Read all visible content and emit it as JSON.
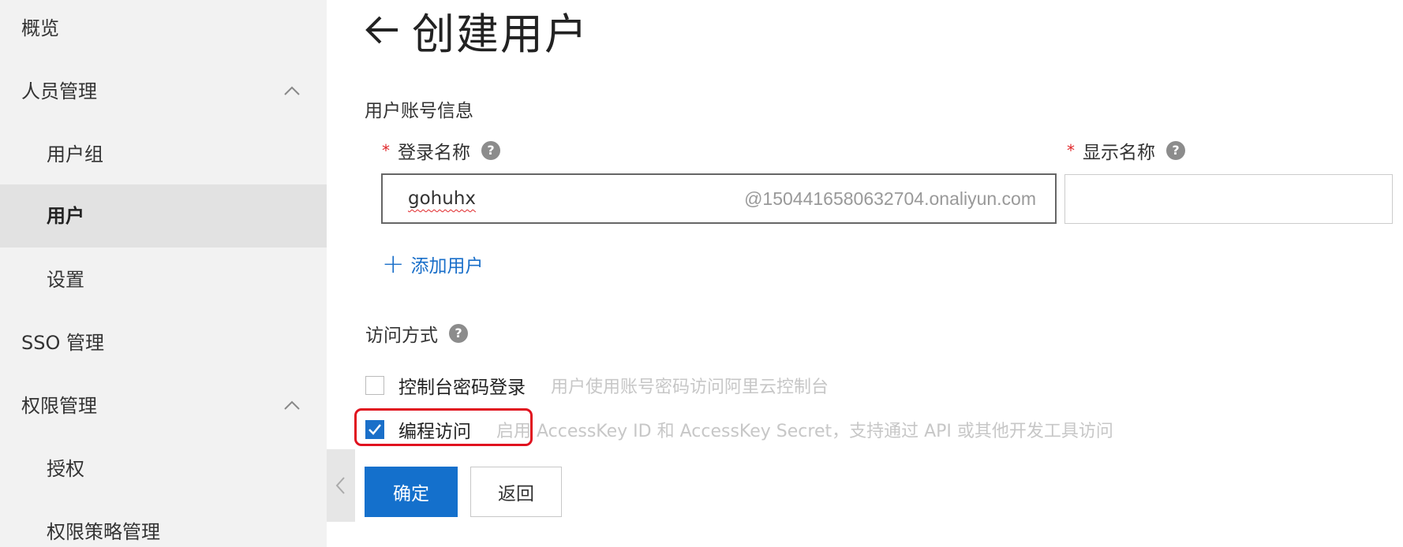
{
  "sidebar": {
    "items": [
      {
        "label": "概览",
        "level": 1
      },
      {
        "label": "人员管理",
        "level": 1,
        "expanded": true
      },
      {
        "label": "用户组",
        "level": 2
      },
      {
        "label": "用户",
        "level": 2,
        "active": true
      },
      {
        "label": "设置",
        "level": 2
      },
      {
        "label": "SSO 管理",
        "level": 1
      },
      {
        "label": "权限管理",
        "level": 1,
        "expanded": true
      },
      {
        "label": "授权",
        "level": 2
      },
      {
        "label": "权限策略管理",
        "level": 2
      }
    ]
  },
  "header": {
    "title": "创建用户",
    "back_icon": "arrow-left-icon"
  },
  "form": {
    "section_account": "用户账号信息",
    "login_name": {
      "label": "登录名称",
      "value": "gohuhx",
      "suffix": "@1504416580632704.onaliyun.com"
    },
    "display_name": {
      "label": "显示名称",
      "value": ""
    },
    "required_mark": "*",
    "help_glyph": "?",
    "add_user": "添加用户",
    "add_glyph": "+",
    "section_access": "访问方式",
    "access_options": [
      {
        "label": "控制台密码登录",
        "description": "用户使用账号密码访问阿里云控制台",
        "checked": false
      },
      {
        "label": "编程访问",
        "description": "启用 AccessKey ID 和 AccessKey Secret，支持通过 API 或其他开发工具访问",
        "checked": true
      }
    ]
  },
  "actions": {
    "confirm": "确定",
    "back": "返回"
  },
  "colors": {
    "accent": "#1470cc",
    "link": "#1a6fc9",
    "required": "#e0272a",
    "highlight": "#e0121f",
    "sidebar_bg": "#f2f2f2",
    "sidebar_active_bg": "#e2e2e2"
  }
}
